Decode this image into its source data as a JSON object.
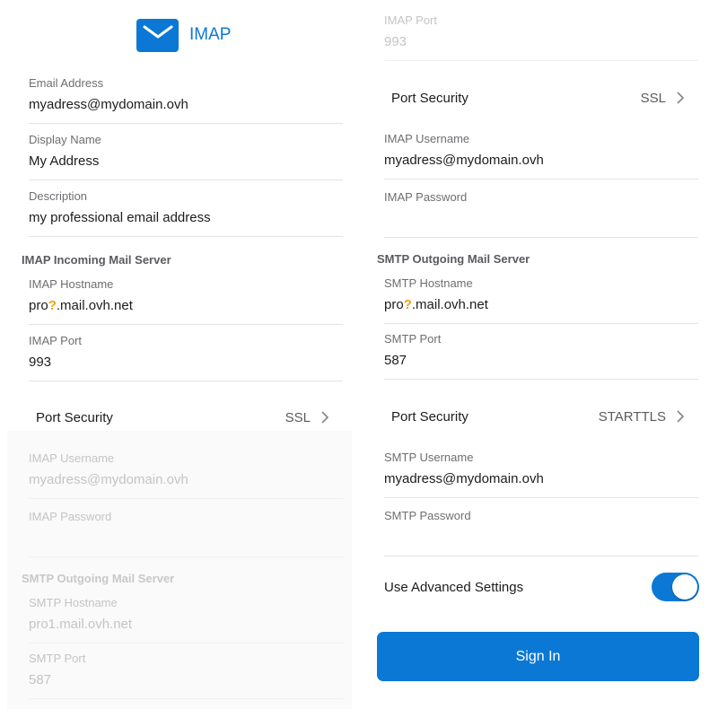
{
  "colors": {
    "accent": "#0a78d4",
    "warning": "#e8a317"
  },
  "left": {
    "header": {
      "icon": "mail-icon",
      "title": "IMAP"
    },
    "email": {
      "label": "Email Address",
      "value": "myadress@mydomain.ovh"
    },
    "display_name": {
      "label": "Display Name",
      "value": "My Address"
    },
    "description": {
      "label": "Description",
      "value": "my professional email address"
    },
    "incoming_section": "IMAP Incoming Mail Server",
    "imap_hostname": {
      "label": "IMAP Hostname",
      "prefix": "pro",
      "mark": "?",
      "suffix": ".mail.ovh.net"
    },
    "imap_port": {
      "label": "IMAP Port",
      "value": "993"
    },
    "port_security": {
      "label": "Port Security",
      "value": "SSL"
    },
    "imap_username": {
      "label": "IMAP Username",
      "value": "myadress@mydomain.ovh"
    },
    "imap_password": {
      "label": "IMAP Password",
      "value": ""
    },
    "outgoing_section": "SMTP Outgoing Mail Server",
    "smtp_hostname": {
      "label": "SMTP Hostname",
      "value": "pro1.mail.ovh.net"
    },
    "smtp_port": {
      "label": "SMTP Port",
      "value": "587"
    }
  },
  "right": {
    "imap_port": {
      "label": "IMAP Port",
      "value": "993"
    },
    "port_security": {
      "label": "Port Security",
      "value": "SSL"
    },
    "imap_username": {
      "label": "IMAP Username",
      "value": "myadress@mydomain.ovh"
    },
    "imap_password": {
      "label": "IMAP Password",
      "value": ""
    },
    "outgoing_section": "SMTP Outgoing Mail Server",
    "smtp_hostname": {
      "label": "SMTP Hostname",
      "prefix": "pro",
      "mark": "?",
      "suffix": ".mail.ovh.net"
    },
    "smtp_port": {
      "label": "SMTP Port",
      "value": "587"
    },
    "smtp_port_security": {
      "label": "Port Security",
      "value": "STARTTLS"
    },
    "smtp_username": {
      "label": "SMTP Username",
      "value": "myadress@mydomain.ovh"
    },
    "smtp_password": {
      "label": "SMTP Password",
      "value": ""
    },
    "advanced": {
      "label": "Use Advanced Settings",
      "enabled": true
    },
    "sign_in": "Sign In"
  }
}
